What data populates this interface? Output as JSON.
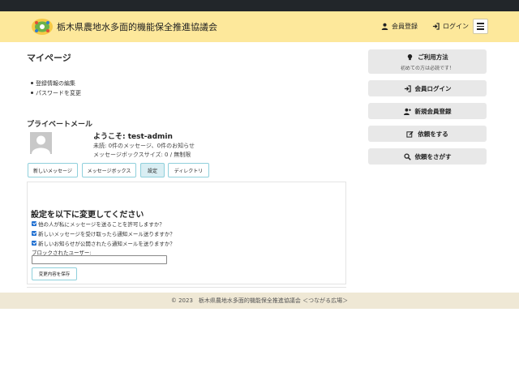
{
  "header": {
    "site_title": "栃木県農地水多面的機能保全推進協議会",
    "register_label": "会員登録",
    "login_label": "ログイン"
  },
  "main": {
    "page_title": "マイページ",
    "account_links": [
      "登録情報の編集",
      "パスワードを変更"
    ],
    "pm_title": "プライベートメール",
    "welcome": "ようこそ: test-admin",
    "stat_unread": "未読: 0件のメッセージ、0件のお知らせ",
    "stat_box_size": "メッセージボックスサイズ: 0 / 無制限",
    "tabs": [
      "新しいメッセージ",
      "メッセージボックス",
      "設定",
      "ディレクトリ"
    ],
    "settings_title": "設定を以下に変更してください",
    "options": [
      "他の人が私にメッセージを送ることを許可しますか？",
      "新しいメッセージを受け取ったら通知メール送りますか？",
      "新しいお知らせが公開されたら通知メールを送りますか？"
    ],
    "block_label": "ブロックされたユーザー:",
    "block_value": "",
    "save_label": "変更内容を保存"
  },
  "sidebar": {
    "usage_label": "ご利用方法",
    "usage_sub": "初めての方は必読です！",
    "member_login_label": "会員ログイン",
    "new_member_label": "新規会員登録",
    "request_label": "依頼をする",
    "search_label": "依頼をさがす"
  },
  "footer": {
    "copyright": "© 2023　栃木県農地水多面的機能保全推進協議会 ＜つながる広場＞"
  },
  "colors": {
    "header_bg": "#fde89b",
    "topbar_bg": "#22262a",
    "footer_bg": "#efe8d5",
    "tab_border": "#8fd0dc",
    "checkbox": "#1f6fd1",
    "sidebar_button_bg": "#e8e8e8"
  }
}
